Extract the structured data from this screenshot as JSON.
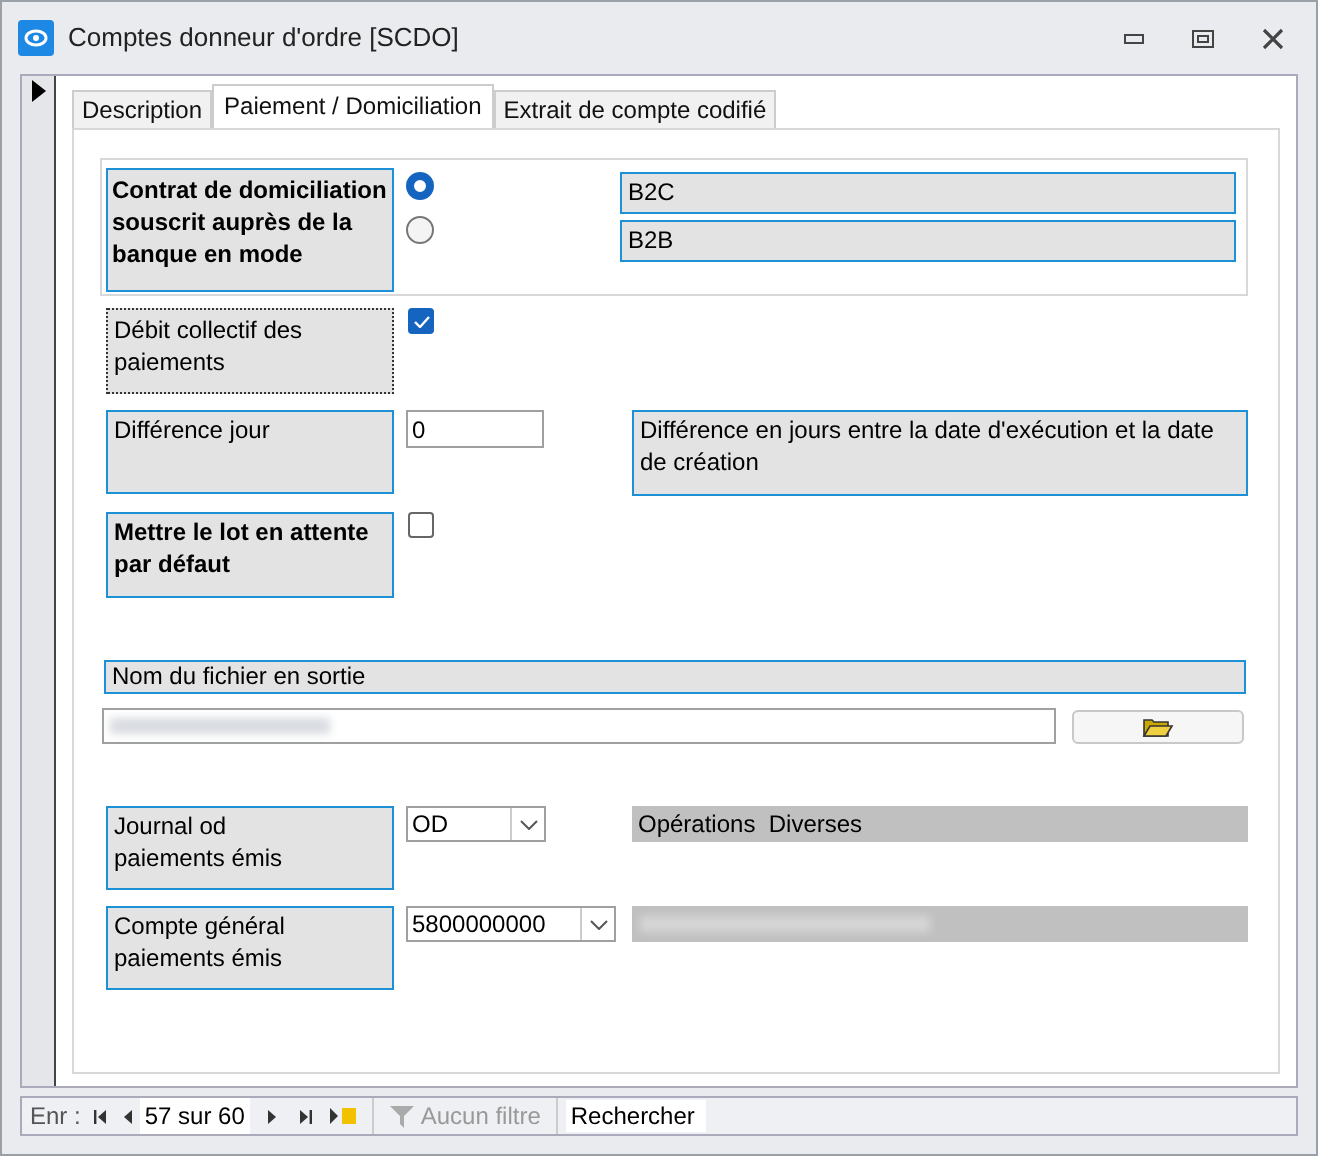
{
  "window": {
    "title": "Comptes donneur d'ordre [SCDO]"
  },
  "tabs": [
    {
      "label": "Description",
      "selected": false
    },
    {
      "label": "Paiement / Domiciliation",
      "selected": true
    },
    {
      "label": "Extrait de compte codifié",
      "selected": false
    }
  ],
  "mode": {
    "label": "Contrat de domiciliation souscrit auprès de la banque en mode",
    "options": [
      {
        "label": "B2C",
        "selected": true
      },
      {
        "label": "B2B",
        "selected": false
      }
    ]
  },
  "debit_collectif": {
    "label": "Débit collectif des paiements",
    "checked": true
  },
  "difference_jour": {
    "label": "Différence jour",
    "value": "0",
    "description": "Différence en jours entre la date d'exécution et la date de création"
  },
  "attente": {
    "label": "Mettre le lot en attente par défaut",
    "checked": false
  },
  "fichier": {
    "label": "Nom du fichier en sortie"
  },
  "journal": {
    "label": "Journal od paiements émis",
    "value": "OD",
    "description": "Opérations  Diverses"
  },
  "compte": {
    "label": "Compte général paiements émis",
    "value": "5800000000"
  },
  "status_bar": {
    "label": "Enr :",
    "position": "57 sur 60",
    "filter": "Aucun filtre",
    "placeholder": "Rechercher"
  }
}
